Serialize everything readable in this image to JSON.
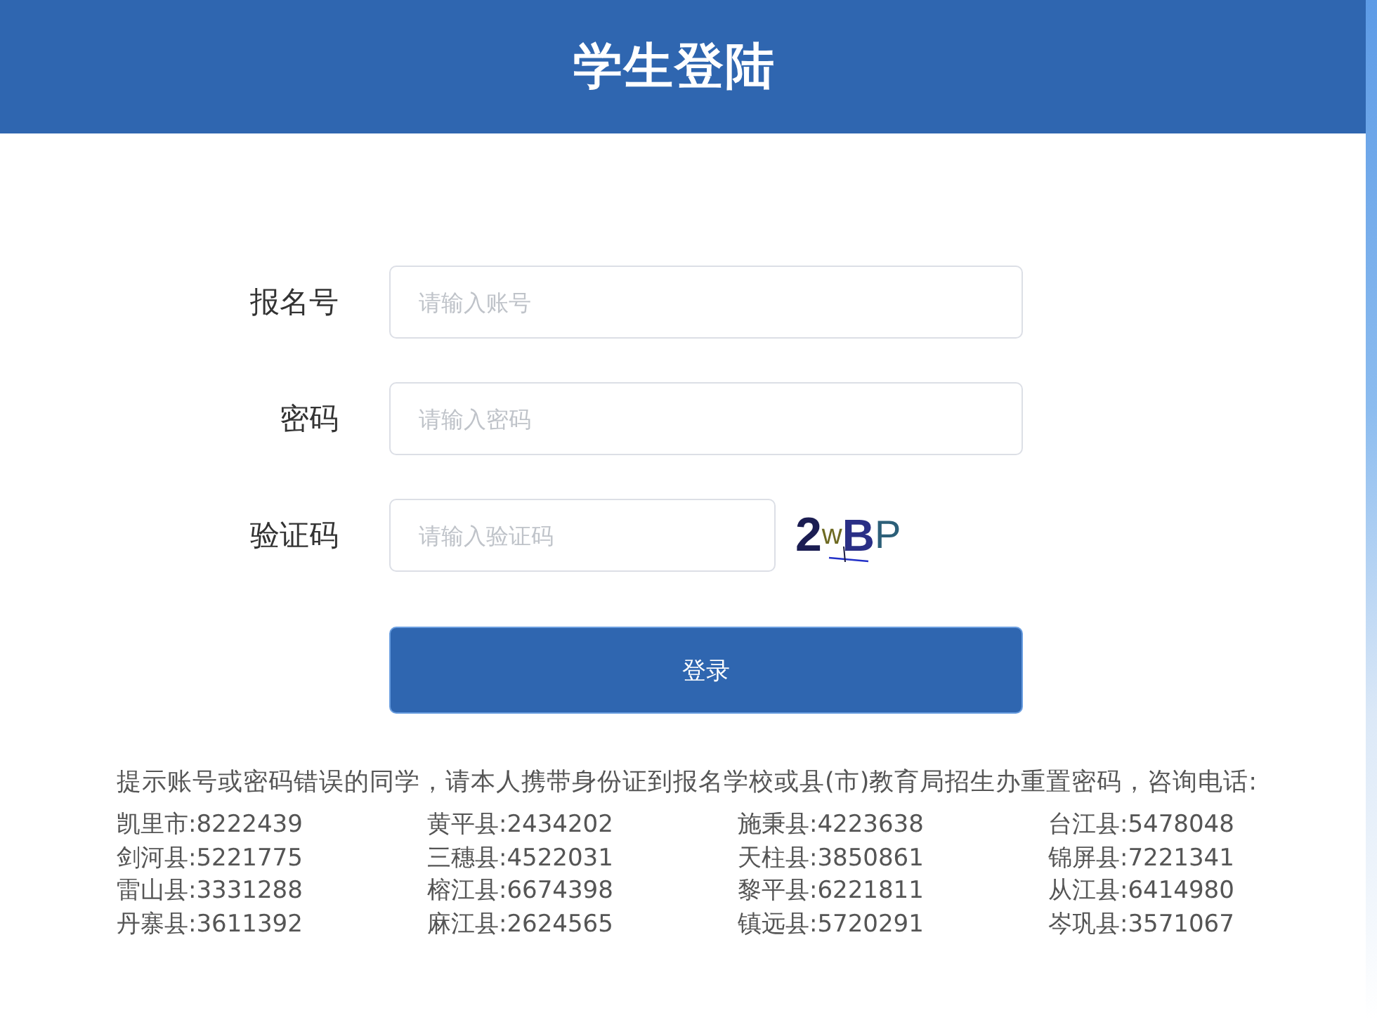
{
  "header": {
    "title": "学生登陆"
  },
  "form": {
    "fields": [
      {
        "kind": "text",
        "label": "报名号",
        "placeholder": "请输入账号"
      },
      {
        "kind": "password",
        "label": "密码",
        "placeholder": "请输入密码"
      },
      {
        "kind": "captcha",
        "label": "验证码",
        "placeholder": "请输入验证码",
        "captcha_text": "2wBP"
      }
    ],
    "submit": "登录"
  },
  "notice": {
    "text": "提示账号或密码错误的同学，请本人携带身份证到报名学校或县(市)教育局招生办重置密码，咨询电话:",
    "contacts": [
      "凯里市:8222439",
      "黄平县:2434202",
      "施秉县:4223638",
      "台江县:5478048",
      "剑河县:5221775",
      "三穗县:4522031",
      "天柱县:3850861",
      "锦屏县:7221341",
      "雷山县:3331288",
      "榕江县:6674398",
      "黎平县:6221811",
      "从江县:6414980",
      "丹寨县:3611392",
      "麻江县:2624565",
      "镇远县:5720291",
      "岑巩县:3571067"
    ]
  }
}
